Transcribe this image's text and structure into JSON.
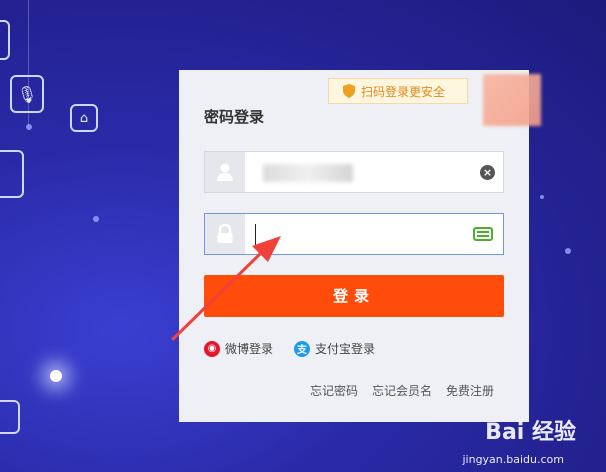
{
  "login": {
    "title": "密码登录",
    "qr_tip": "扫码登录更安全",
    "username_value": "",
    "password_value": "",
    "submit_label": "登录",
    "third_party": [
      {
        "label": "微博登录",
        "icon": "weibo-icon",
        "color": "#e6162d"
      },
      {
        "label": "支付宝登录",
        "icon": "alipay-icon",
        "color": "#1a9bf0"
      }
    ],
    "footer_links": [
      "忘记密码",
      "忘记会员名",
      "免费注册"
    ]
  },
  "watermark": {
    "brand": "Bai 经验",
    "url": "jingyan.baidu.com"
  },
  "colors": {
    "accent": "#ff4c0a",
    "background": "#23208f"
  }
}
